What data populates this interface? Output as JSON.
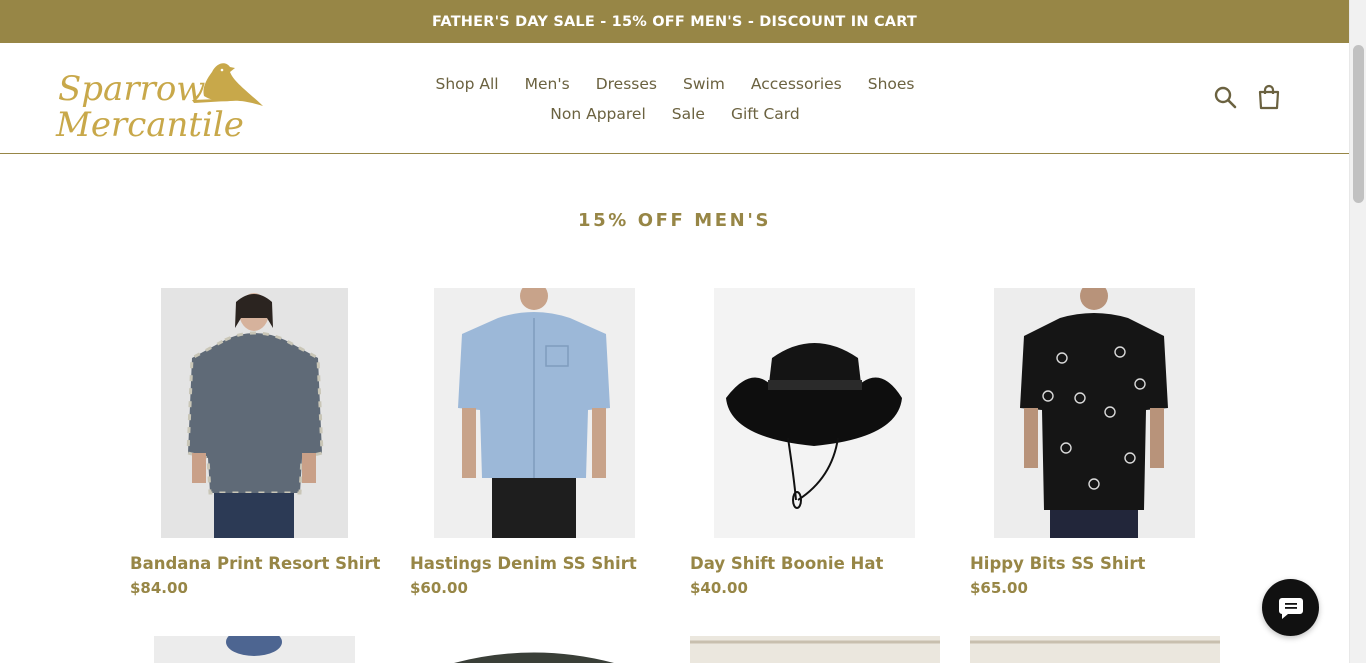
{
  "announcement": {
    "text": "FATHER'S DAY SALE - 15% OFF MEN'S - DISCOUNT IN CART"
  },
  "brand": {
    "name_line1": "Sparrow",
    "name_line2": "Mercantile",
    "color": "#978646"
  },
  "nav": {
    "row1": [
      "Shop All",
      "Men's",
      "Dresses",
      "Swim",
      "Accessories",
      "Shoes"
    ],
    "row2": [
      "Non Apparel",
      "Sale",
      "Gift Card"
    ]
  },
  "header_icons": {
    "search": "search-icon",
    "cart": "cart-icon"
  },
  "collection": {
    "title": "15% OFF MEN'S"
  },
  "products": [
    {
      "title": "Bandana Print Resort Shirt",
      "price": "$84.00"
    },
    {
      "title": "Hastings Denim SS Shirt",
      "price": "$60.00"
    },
    {
      "title": "Day Shift Boonie Hat",
      "price": "$40.00"
    },
    {
      "title": "Hippy Bits SS Shirt",
      "price": "$65.00"
    }
  ],
  "chat": {
    "icon": "chat-icon"
  },
  "colors": {
    "accent": "#978646",
    "bar": "#978646",
    "text": "#6b6240"
  }
}
